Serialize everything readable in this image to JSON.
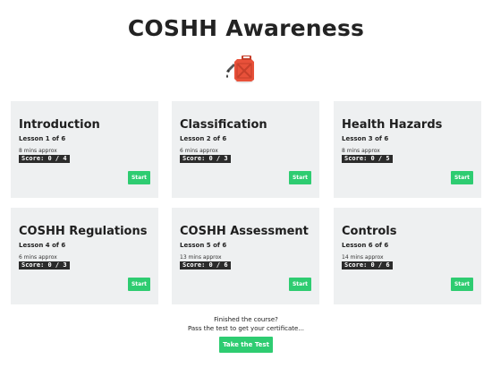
{
  "page_title": "COSHH Awareness",
  "hero_icon": "fuel-can-icon",
  "colors": {
    "accent": "#2ecc71",
    "card_bg": "#eef0f1",
    "score_bg": "#2b2b2b",
    "icon_red": "#e8513a"
  },
  "lessons": [
    {
      "title": "Introduction",
      "lesson": "Lesson 1 of 6",
      "mins": "8 mins approx",
      "score": "Score: 0 / 4",
      "start_label": "Start"
    },
    {
      "title": "Classification",
      "lesson": "Lesson 2 of 6",
      "mins": "6 mins approx",
      "score": "Score: 0 / 3",
      "start_label": "Start"
    },
    {
      "title": "Health Hazards",
      "lesson": "Lesson 3 of 6",
      "mins": "8 mins approx",
      "score": "Score: 0 / 5",
      "start_label": "Start"
    },
    {
      "title": "COSHH Regulations",
      "lesson": "Lesson 4 of 6",
      "mins": "6 mins approx",
      "score": "Score: 0 / 3",
      "start_label": "Start"
    },
    {
      "title": "COSHH Assessment",
      "lesson": "Lesson 5 of 6",
      "mins": "13 mins approx",
      "score": "Score: 0 / 6",
      "start_label": "Start"
    },
    {
      "title": "Controls",
      "lesson": "Lesson 6 of 6",
      "mins": "14 mins approx",
      "score": "Score: 0 / 6",
      "start_label": "Start"
    }
  ],
  "footer": {
    "line1": "Finished the course?",
    "line2": "Pass the test to get your certificate...",
    "button_label": "Take the Test"
  }
}
